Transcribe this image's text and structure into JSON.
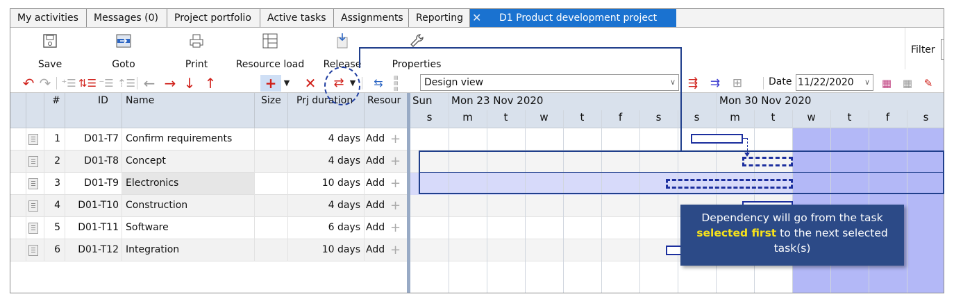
{
  "tabs": [
    {
      "label": "My activities"
    },
    {
      "label": "Messages (0)"
    },
    {
      "label": "Project portfolio"
    },
    {
      "label": "Active tasks"
    },
    {
      "label": "Assignments"
    },
    {
      "label": "Reporting"
    }
  ],
  "active_tab": {
    "label": "D1 Product development project",
    "close_icon": "x-icon"
  },
  "ribbon": {
    "save": "Save",
    "goto": "Goto",
    "print": "Print",
    "resource_load": "Resource load",
    "release": "Release",
    "properties": "Properties",
    "filter": "Filter"
  },
  "toolbar": {
    "view_select": "Design view",
    "date_label": "Date",
    "date_value": "11/22/2020"
  },
  "grid": {
    "columns": [
      "#",
      "ID",
      "Name",
      "Size",
      "Prj duration",
      "Resour"
    ],
    "rows": [
      {
        "num": "1",
        "id": "D01-T7",
        "name": "Confirm requirements",
        "size": "",
        "duration": "4 days",
        "resource": "Add"
      },
      {
        "num": "2",
        "id": "D01-T8",
        "name": "Concept",
        "size": "",
        "duration": "4 days",
        "resource": "Add"
      },
      {
        "num": "3",
        "id": "D01-T9",
        "name": "Electronics",
        "size": "",
        "duration": "10 days",
        "resource": "Add"
      },
      {
        "num": "4",
        "id": "D01-T10",
        "name": "Construction",
        "size": "",
        "duration": "4 days",
        "resource": "Add"
      },
      {
        "num": "5",
        "id": "D01-T11",
        "name": "Software",
        "size": "",
        "duration": "6 days",
        "resource": "Add"
      },
      {
        "num": "6",
        "id": "D01-T12",
        "name": "Integration",
        "size": "",
        "duration": "10 days",
        "resource": "Add"
      }
    ]
  },
  "gantt": {
    "first_day": "Sun",
    "week1": "Mon 23 Nov 2020",
    "week2": "Mon 30 Nov 2020",
    "days": [
      "s",
      "m",
      "t",
      "w",
      "t",
      "f",
      "s",
      "s",
      "m",
      "t",
      "w",
      "t",
      "f",
      "s"
    ]
  },
  "callout": {
    "part1": "Dependency will go from the task",
    "highlight": "selected first",
    "part2": "to the next selected task(s)"
  },
  "colors": {
    "accent": "#1a72d0",
    "bar": "#1c2f9e",
    "highlight": "#b3b8f7",
    "callout": "#2c4a87",
    "callout_highlight": "#f7e21a"
  }
}
